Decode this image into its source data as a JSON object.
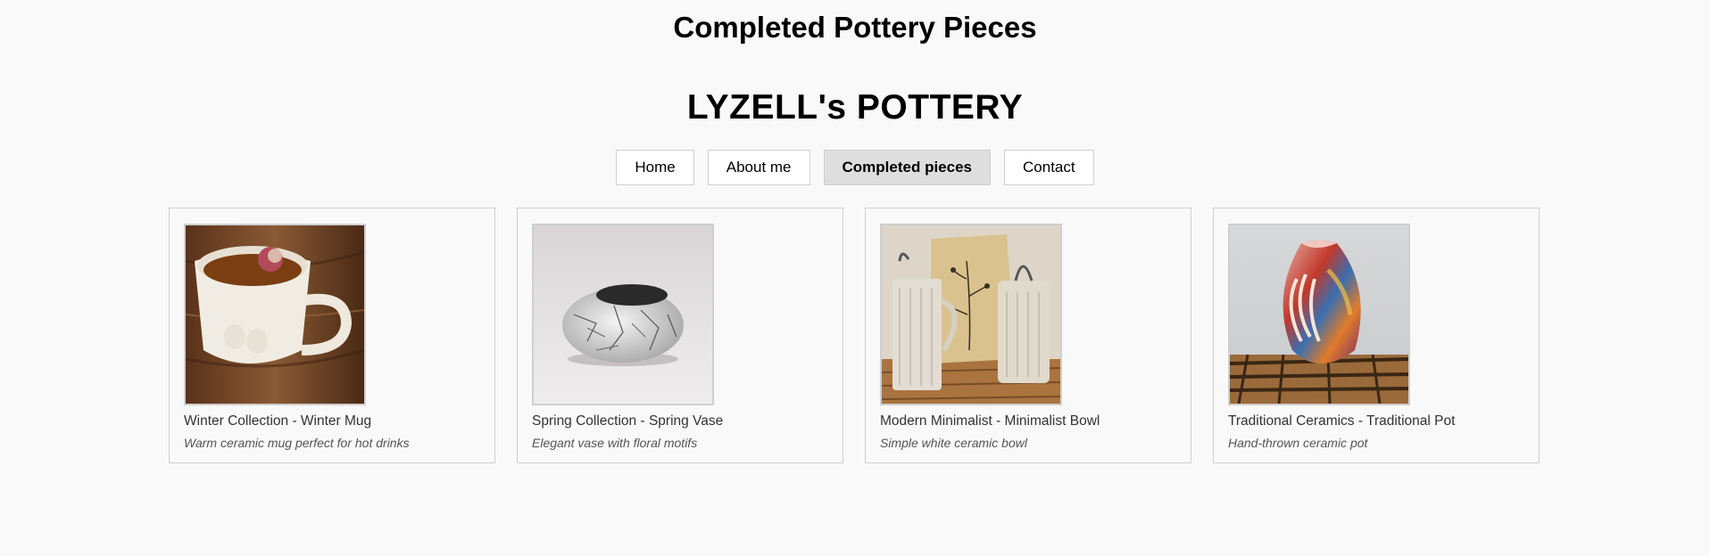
{
  "page": {
    "heading": "Completed Pottery Pieces",
    "brand": "LYZELL's POTTERY"
  },
  "nav": {
    "items": [
      {
        "label": "Home",
        "active": false
      },
      {
        "label": "About me",
        "active": false
      },
      {
        "label": "Completed pieces",
        "active": true
      },
      {
        "label": "Contact",
        "active": false
      }
    ]
  },
  "gallery": {
    "items": [
      {
        "title": "Winter Collection - Winter Mug",
        "description": "Warm ceramic mug perfect for hot drinks",
        "image": "white-mug-with-tea-photo"
      },
      {
        "title": "Spring Collection - Spring Vase",
        "description": "Elegant vase with floral motifs",
        "image": "raku-crackle-pot-photo"
      },
      {
        "title": "Modern Minimalist - Minimalist Bowl",
        "description": "Simple white ceramic bowl",
        "image": "textured-jars-and-vase-photo"
      },
      {
        "title": "Traditional Ceramics - Traditional Pot",
        "description": "Hand-thrown ceramic pot",
        "image": "colorful-raku-vase-photo"
      }
    ]
  },
  "colors": {
    "background": "#f9f9f9",
    "border": "#cfcfcf",
    "active_nav": "#dedede"
  }
}
